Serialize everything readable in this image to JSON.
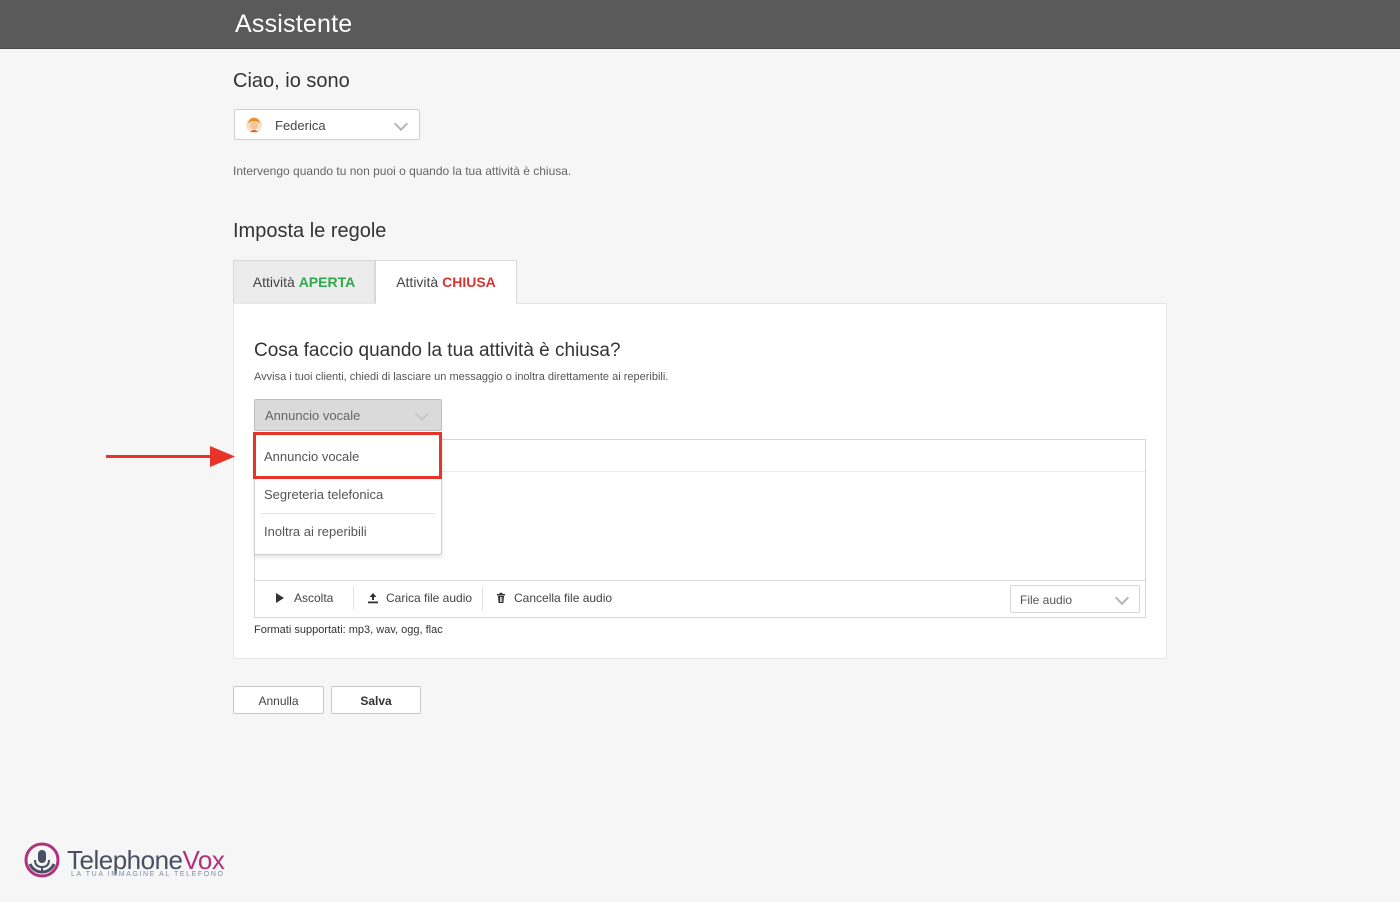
{
  "header": {
    "title": "Assistente"
  },
  "assistant": {
    "greeting": "Ciao, io sono",
    "selected": "Federica",
    "description": "Intervengo quando tu non puoi o quando la tua attività è chiusa."
  },
  "rules": {
    "title": "Imposta le regole",
    "tabs": [
      {
        "prefix": "Attività",
        "status": "APERTA",
        "color": "#2ea84a",
        "active": false
      },
      {
        "prefix": "Attività",
        "status": "CHIUSA",
        "color": "#d63333",
        "active": true
      }
    ]
  },
  "panel": {
    "title": "Cosa faccio quando la tua attività è chiusa?",
    "subtitle": "Avvisa i tuoi clienti, chiedi di lasciare un messaggio o inoltra direttamente ai reperibili.",
    "action_selected": "Annuncio vocale",
    "action_options": [
      "Annuncio vocale",
      "Segreteria telefonica",
      "Inoltra ai reperibili"
    ],
    "toolbar": {
      "listen": "Ascolta",
      "upload": "Carica file audio",
      "delete": "Cancella file audio",
      "file_select": "File audio"
    },
    "formats": "Formati supportati: mp3, wav, ogg, flac"
  },
  "footer_buttons": {
    "cancel": "Annulla",
    "save": "Salva"
  },
  "logo": {
    "brand_main": "Telephone",
    "brand_accent": "Vox",
    "tagline": "LA TUA IMMAGINE AL TELEFONO"
  },
  "colors": {
    "header_bg": "#5a5a5a",
    "highlight": "#e8332a",
    "open": "#2ea84a",
    "closed": "#d63333"
  },
  "icons": [
    "chevron-down-icon",
    "play-icon",
    "upload-icon",
    "trash-icon",
    "avatar",
    "arrow-right-icon",
    "logo-mark"
  ]
}
